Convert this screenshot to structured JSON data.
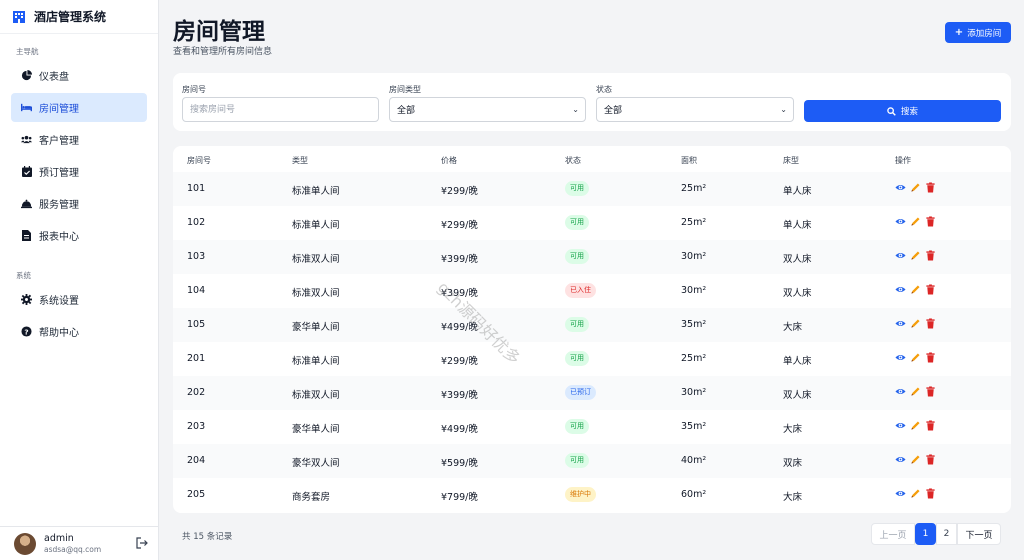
{
  "app": {
    "title": "酒店管理系统"
  },
  "sidebar": {
    "section_main": "主导航",
    "items": [
      {
        "label": "仪表盘",
        "icon": "pie-chart-icon"
      },
      {
        "label": "房间管理",
        "icon": "bed-icon",
        "active": true
      },
      {
        "label": "客户管理",
        "icon": "users-icon"
      },
      {
        "label": "预订管理",
        "icon": "calendar-check-icon"
      },
      {
        "label": "服务管理",
        "icon": "bell-icon"
      },
      {
        "label": "报表中心",
        "icon": "file-icon"
      }
    ],
    "section_system": "系统",
    "system_items": [
      {
        "label": "系统设置",
        "icon": "gear-icon"
      },
      {
        "label": "帮助中心",
        "icon": "help-icon"
      }
    ]
  },
  "user": {
    "name": "admin",
    "email": "asdsa@qq.com"
  },
  "header": {
    "title": "房间管理",
    "subtitle": "查看和管理所有房间信息",
    "add_button": "添加房间"
  },
  "filters": {
    "room_no_label": "房间号",
    "room_no_placeholder": "搜索房间号",
    "room_no_value": "",
    "type_label": "房间类型",
    "type_value": "全部",
    "status_label": "状态",
    "status_value": "全部",
    "search_button": "搜索"
  },
  "table": {
    "columns": [
      "房间号",
      "类型",
      "价格",
      "状态",
      "面积",
      "床型",
      "操作"
    ],
    "rows": [
      {
        "room": "101",
        "type": "标准单人间",
        "price": "¥299/晚",
        "status": "可用",
        "status_color": "green",
        "area": "25m²",
        "bed": "单人床"
      },
      {
        "room": "102",
        "type": "标准单人间",
        "price": "¥299/晚",
        "status": "可用",
        "status_color": "green",
        "area": "25m²",
        "bed": "单人床"
      },
      {
        "room": "103",
        "type": "标准双人间",
        "price": "¥399/晚",
        "status": "可用",
        "status_color": "green",
        "area": "30m²",
        "bed": "双人床"
      },
      {
        "room": "104",
        "type": "标准双人间",
        "price": "¥399/晚",
        "status": "已入住",
        "status_color": "red",
        "area": "30m²",
        "bed": "双人床"
      },
      {
        "room": "105",
        "type": "豪华单人间",
        "price": "¥499/晚",
        "status": "可用",
        "status_color": "green",
        "area": "35m²",
        "bed": "大床"
      },
      {
        "room": "201",
        "type": "标准单人间",
        "price": "¥299/晚",
        "status": "可用",
        "status_color": "green",
        "area": "25m²",
        "bed": "单人床"
      },
      {
        "room": "202",
        "type": "标准双人间",
        "price": "¥399/晚",
        "status": "已预订",
        "status_color": "blue",
        "area": "30m²",
        "bed": "双人床"
      },
      {
        "room": "203",
        "type": "豪华单人间",
        "price": "¥499/晚",
        "status": "可用",
        "status_color": "green",
        "area": "35m²",
        "bed": "大床"
      },
      {
        "room": "204",
        "type": "豪华双人间",
        "price": "¥599/晚",
        "status": "可用",
        "status_color": "green",
        "area": "40m²",
        "bed": "双床"
      },
      {
        "room": "205",
        "type": "商务套房",
        "price": "¥799/晚",
        "status": "维护中",
        "status_color": "yellow",
        "area": "60m²",
        "bed": "大床"
      }
    ]
  },
  "footer": {
    "total_text": "共 15 条记录",
    "prev": "上一页",
    "pages": [
      "1",
      "2"
    ],
    "current_page": 1,
    "next": "下一页"
  },
  "watermark": "gzh源码好优多",
  "colors": {
    "primary": "#1d5cf5",
    "sidebar_active_bg": "#dbeafe",
    "background": "#f3f4f6"
  }
}
